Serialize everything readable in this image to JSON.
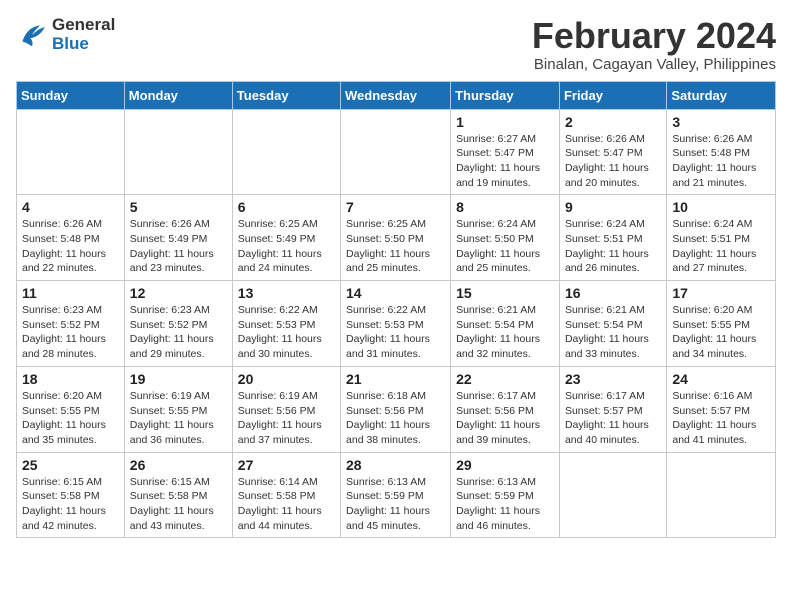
{
  "logo": {
    "line1": "General",
    "line2": "Blue"
  },
  "title": "February 2024",
  "subtitle": "Binalan, Cagayan Valley, Philippines",
  "days_of_week": [
    "Sunday",
    "Monday",
    "Tuesday",
    "Wednesday",
    "Thursday",
    "Friday",
    "Saturday"
  ],
  "weeks": [
    [
      {
        "day": "",
        "info": ""
      },
      {
        "day": "",
        "info": ""
      },
      {
        "day": "",
        "info": ""
      },
      {
        "day": "",
        "info": ""
      },
      {
        "day": "1",
        "info": "Sunrise: 6:27 AM\nSunset: 5:47 PM\nDaylight: 11 hours and 19 minutes."
      },
      {
        "day": "2",
        "info": "Sunrise: 6:26 AM\nSunset: 5:47 PM\nDaylight: 11 hours and 20 minutes."
      },
      {
        "day": "3",
        "info": "Sunrise: 6:26 AM\nSunset: 5:48 PM\nDaylight: 11 hours and 21 minutes."
      }
    ],
    [
      {
        "day": "4",
        "info": "Sunrise: 6:26 AM\nSunset: 5:48 PM\nDaylight: 11 hours and 22 minutes."
      },
      {
        "day": "5",
        "info": "Sunrise: 6:26 AM\nSunset: 5:49 PM\nDaylight: 11 hours and 23 minutes."
      },
      {
        "day": "6",
        "info": "Sunrise: 6:25 AM\nSunset: 5:49 PM\nDaylight: 11 hours and 24 minutes."
      },
      {
        "day": "7",
        "info": "Sunrise: 6:25 AM\nSunset: 5:50 PM\nDaylight: 11 hours and 25 minutes."
      },
      {
        "day": "8",
        "info": "Sunrise: 6:24 AM\nSunset: 5:50 PM\nDaylight: 11 hours and 25 minutes."
      },
      {
        "day": "9",
        "info": "Sunrise: 6:24 AM\nSunset: 5:51 PM\nDaylight: 11 hours and 26 minutes."
      },
      {
        "day": "10",
        "info": "Sunrise: 6:24 AM\nSunset: 5:51 PM\nDaylight: 11 hours and 27 minutes."
      }
    ],
    [
      {
        "day": "11",
        "info": "Sunrise: 6:23 AM\nSunset: 5:52 PM\nDaylight: 11 hours and 28 minutes."
      },
      {
        "day": "12",
        "info": "Sunrise: 6:23 AM\nSunset: 5:52 PM\nDaylight: 11 hours and 29 minutes."
      },
      {
        "day": "13",
        "info": "Sunrise: 6:22 AM\nSunset: 5:53 PM\nDaylight: 11 hours and 30 minutes."
      },
      {
        "day": "14",
        "info": "Sunrise: 6:22 AM\nSunset: 5:53 PM\nDaylight: 11 hours and 31 minutes."
      },
      {
        "day": "15",
        "info": "Sunrise: 6:21 AM\nSunset: 5:54 PM\nDaylight: 11 hours and 32 minutes."
      },
      {
        "day": "16",
        "info": "Sunrise: 6:21 AM\nSunset: 5:54 PM\nDaylight: 11 hours and 33 minutes."
      },
      {
        "day": "17",
        "info": "Sunrise: 6:20 AM\nSunset: 5:55 PM\nDaylight: 11 hours and 34 minutes."
      }
    ],
    [
      {
        "day": "18",
        "info": "Sunrise: 6:20 AM\nSunset: 5:55 PM\nDaylight: 11 hours and 35 minutes."
      },
      {
        "day": "19",
        "info": "Sunrise: 6:19 AM\nSunset: 5:55 PM\nDaylight: 11 hours and 36 minutes."
      },
      {
        "day": "20",
        "info": "Sunrise: 6:19 AM\nSunset: 5:56 PM\nDaylight: 11 hours and 37 minutes."
      },
      {
        "day": "21",
        "info": "Sunrise: 6:18 AM\nSunset: 5:56 PM\nDaylight: 11 hours and 38 minutes."
      },
      {
        "day": "22",
        "info": "Sunrise: 6:17 AM\nSunset: 5:56 PM\nDaylight: 11 hours and 39 minutes."
      },
      {
        "day": "23",
        "info": "Sunrise: 6:17 AM\nSunset: 5:57 PM\nDaylight: 11 hours and 40 minutes."
      },
      {
        "day": "24",
        "info": "Sunrise: 6:16 AM\nSunset: 5:57 PM\nDaylight: 11 hours and 41 minutes."
      }
    ],
    [
      {
        "day": "25",
        "info": "Sunrise: 6:15 AM\nSunset: 5:58 PM\nDaylight: 11 hours and 42 minutes."
      },
      {
        "day": "26",
        "info": "Sunrise: 6:15 AM\nSunset: 5:58 PM\nDaylight: 11 hours and 43 minutes."
      },
      {
        "day": "27",
        "info": "Sunrise: 6:14 AM\nSunset: 5:58 PM\nDaylight: 11 hours and 44 minutes."
      },
      {
        "day": "28",
        "info": "Sunrise: 6:13 AM\nSunset: 5:59 PM\nDaylight: 11 hours and 45 minutes."
      },
      {
        "day": "29",
        "info": "Sunrise: 6:13 AM\nSunset: 5:59 PM\nDaylight: 11 hours and 46 minutes."
      },
      {
        "day": "",
        "info": ""
      },
      {
        "day": "",
        "info": ""
      }
    ]
  ]
}
